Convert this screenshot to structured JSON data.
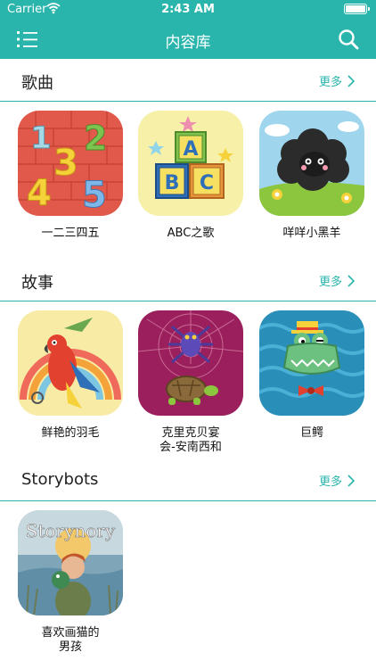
{
  "status_bar": {
    "carrier": "Carrier",
    "time": "2:43 AM"
  },
  "nav": {
    "title": "内容库"
  },
  "colors": {
    "accent": "#2ab5ac"
  },
  "icons": {
    "menu": "list-menu-icon",
    "search": "search-icon",
    "more": "chevron-right-icon"
  },
  "sections": [
    {
      "title": "歌曲",
      "more_label": "更多",
      "items": [
        {
          "label": "一二三四五"
        },
        {
          "label": "ABC之歌",
          "art_text": [
            "A",
            "B",
            "C"
          ]
        },
        {
          "label": "咩咩小黑羊"
        }
      ]
    },
    {
      "title": "故事",
      "more_label": "更多",
      "items": [
        {
          "label": "鲜艳的羽毛"
        },
        {
          "label_lines": [
            "克里克贝宴",
            "会-安南西和"
          ]
        },
        {
          "label": "巨鳄"
        }
      ]
    },
    {
      "title": "Storybots",
      "more_label": "更多",
      "items": [
        {
          "label_lines": [
            "喜欢画猫的",
            "男孩"
          ],
          "art_text": "Storynory"
        }
      ]
    }
  ]
}
